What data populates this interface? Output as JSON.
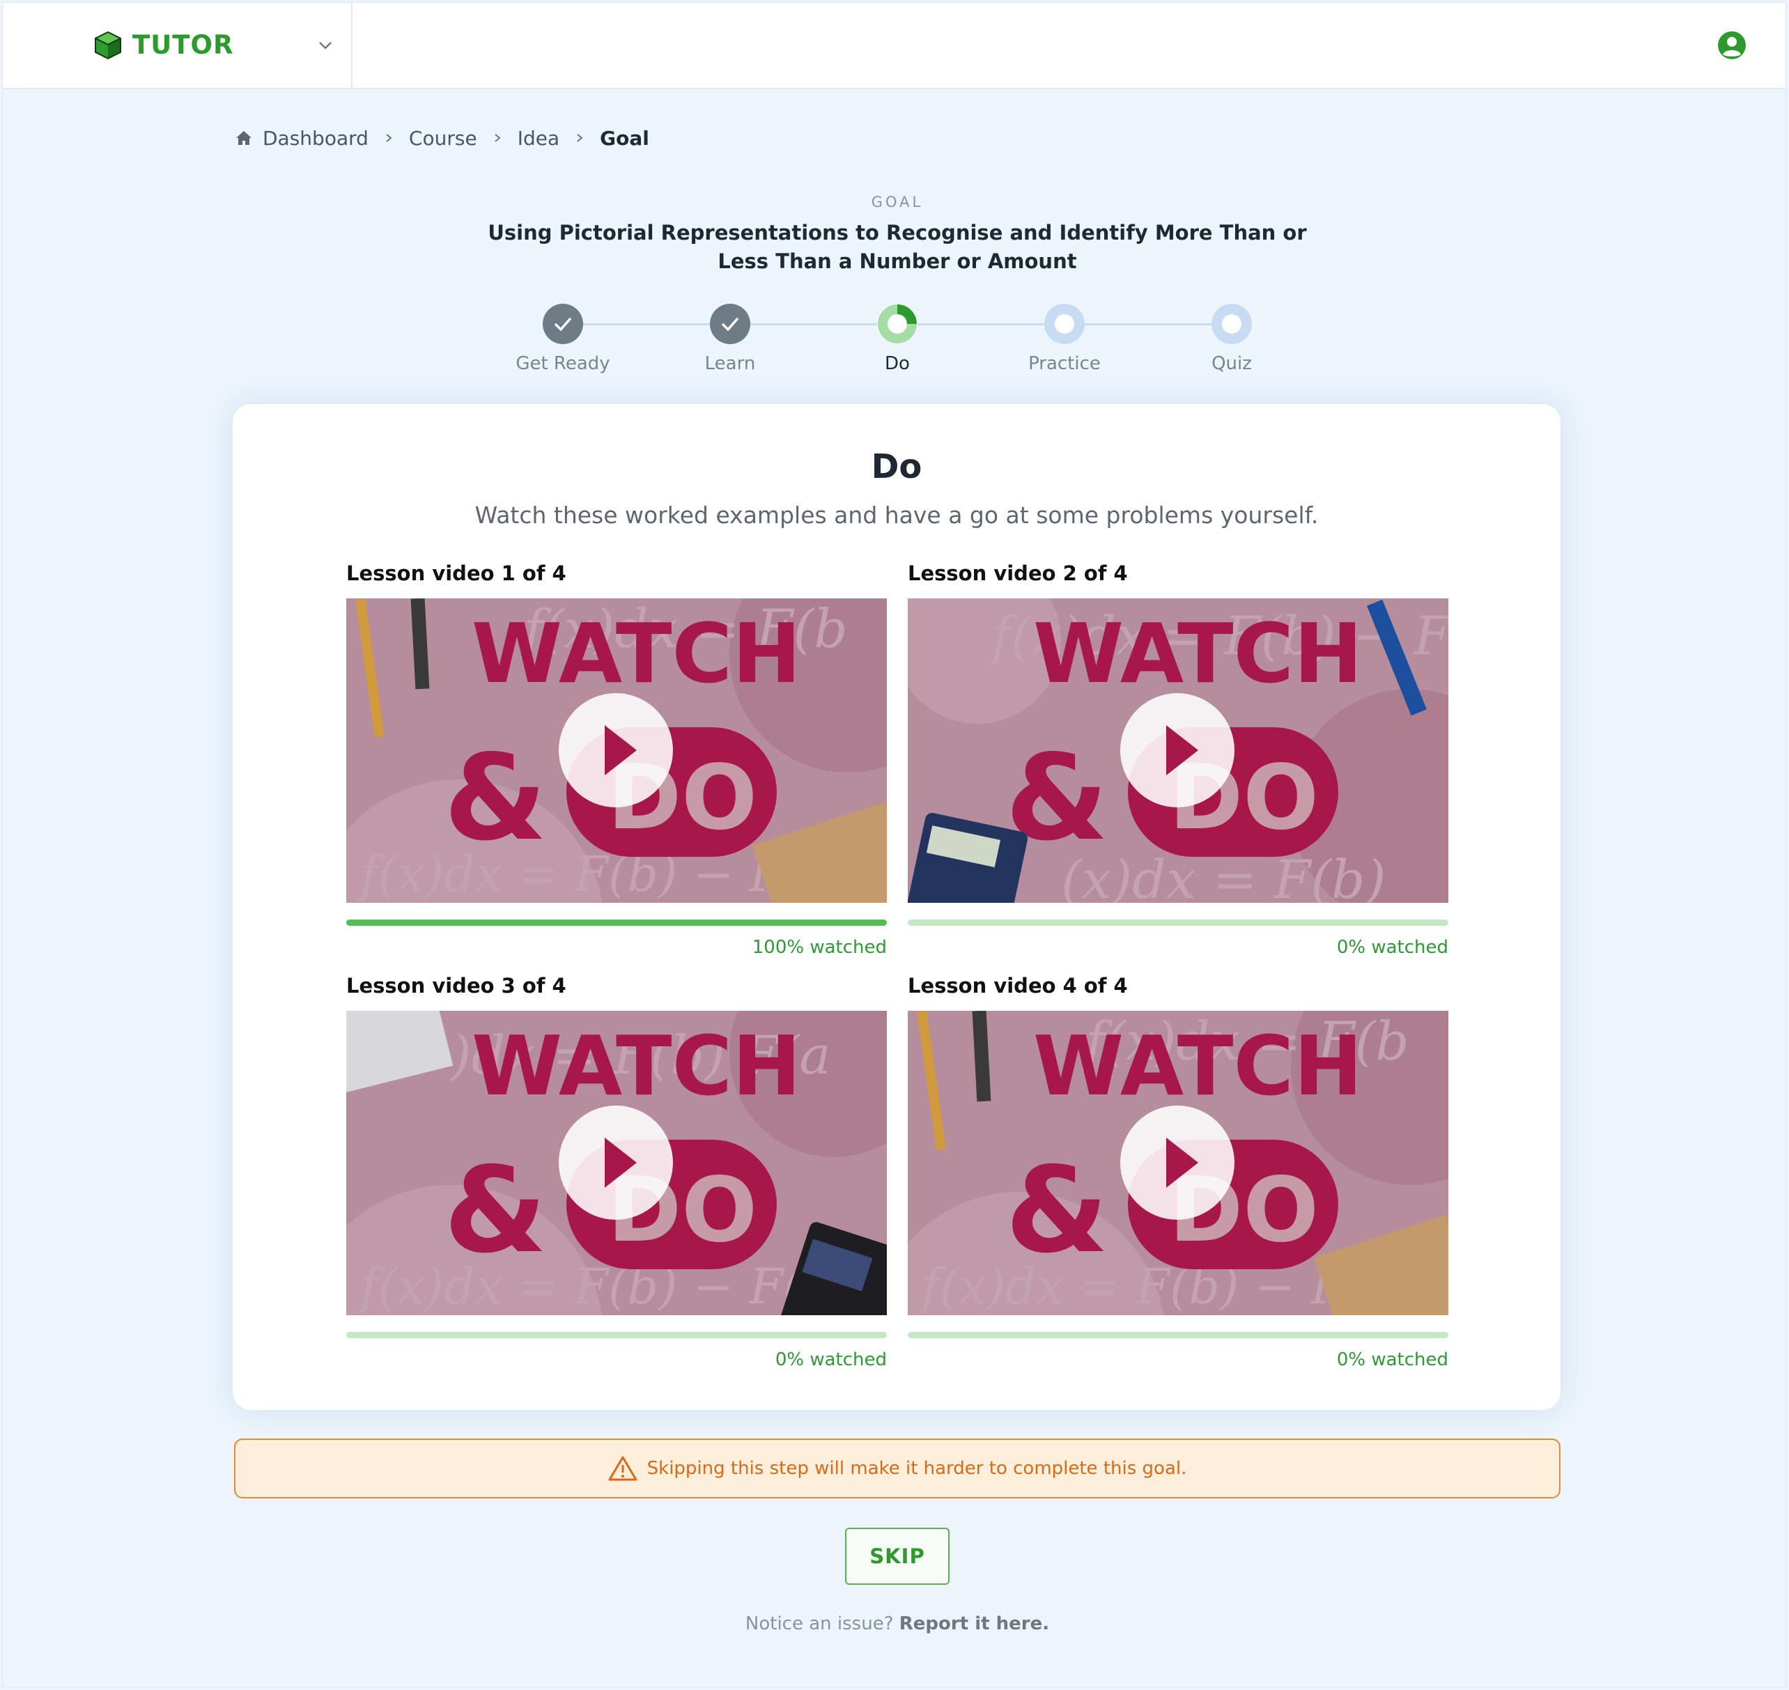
{
  "header": {
    "brand_name": "TUTOR",
    "brand_color": "#2c9a2c",
    "logo_icon": "green-cube-icon",
    "menu_icon": "chevron-down-icon",
    "user_icon": "account-circle-icon"
  },
  "breadcrumb": {
    "items": [
      "Dashboard",
      "Course",
      "Idea"
    ],
    "current": "Goal"
  },
  "goal": {
    "label": "GOAL",
    "title": "Using Pictorial Representations to Recognise and Identify More Than or Less Than a Number or Amount"
  },
  "stepper": {
    "steps": [
      {
        "label": "Get Ready",
        "state": "completed"
      },
      {
        "label": "Learn",
        "state": "completed"
      },
      {
        "label": "Do",
        "state": "active"
      },
      {
        "label": "Practice",
        "state": "pending"
      },
      {
        "label": "Quiz",
        "state": "pending"
      }
    ]
  },
  "card": {
    "title": "Do",
    "subtitle": "Watch these worked examples and have a go at some problems yourself.",
    "videos": [
      {
        "title": "Lesson video 1 of 4",
        "thumb_line1": "WATCH",
        "thumb_line2": "&",
        "thumb_line3": "DO",
        "progress": 1.0,
        "watched_label": "100% watched"
      },
      {
        "title": "Lesson video 2 of 4",
        "thumb_line1": "WATCH",
        "thumb_line2": "&",
        "thumb_line3": "DO",
        "progress": 0.0,
        "watched_label": "0% watched"
      },
      {
        "title": "Lesson video 3 of 4",
        "thumb_line1": "WATCH",
        "thumb_line2": "&",
        "thumb_line3": "DO",
        "progress": 0.0,
        "watched_label": "0% watched"
      },
      {
        "title": "Lesson video 4 of 4",
        "thumb_line1": "WATCH",
        "thumb_line2": "&",
        "thumb_line3": "DO",
        "progress": 0.0,
        "watched_label": "0% watched"
      }
    ]
  },
  "warning": {
    "icon": "warning-triangle-icon",
    "text": "Skipping this step will make it harder to complete this goal."
  },
  "skip_label": "SKIP",
  "report": {
    "prefix": "Notice an issue?",
    "link": "Report it here."
  },
  "colors": {
    "accent_green": "#2c9a2c",
    "progress_full": "#55bd55",
    "progress_track": "#c4e7c4",
    "warning_border": "#e68a35",
    "warning_bg": "#fdefdb",
    "thumb_magenta": "#a8174a"
  }
}
